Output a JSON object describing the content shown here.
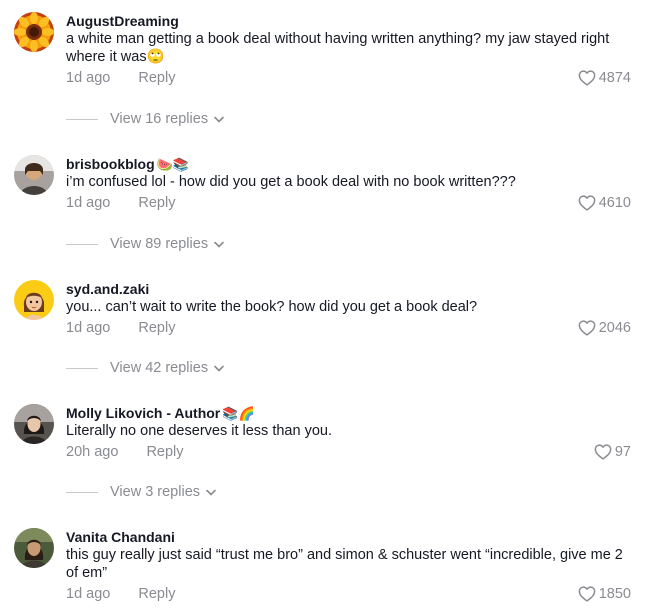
{
  "comments": [
    {
      "username": "AugustDreaming",
      "username_emoji": "",
      "text": "a white man getting a book deal without having written anything? my jaw stayed right where it was🙄",
      "time": "1d ago",
      "reply_label": "Reply",
      "likes": "4874",
      "view_replies": "View 16 replies",
      "avatar": "sunflower-avatar"
    },
    {
      "username": "brisbookblog",
      "username_emoji": "🍉📚",
      "text": "i’m confused lol - how did you get a book deal with no book written???",
      "time": "1d ago",
      "reply_label": "Reply",
      "likes": "4610",
      "view_replies": "View 89 replies",
      "avatar": "person-photo-avatar"
    },
    {
      "username": "syd.and.zaki",
      "username_emoji": "",
      "text": "you... can’t wait to write the book? how did you get a book deal?",
      "time": "1d ago",
      "reply_label": "Reply",
      "likes": "2046",
      "view_replies": "View 42 replies",
      "avatar": "memoji-avatar"
    },
    {
      "username": "Molly Likovich - Author",
      "username_emoji": "📚🌈",
      "text": "Literally no one deserves it less than you.",
      "time": "20h ago",
      "reply_label": "Reply",
      "likes": "97",
      "view_replies": "View 3 replies",
      "avatar": "person-photo-avatar"
    },
    {
      "username": "Vanita Chandani",
      "username_emoji": "",
      "text": "this guy really just said “trust me bro” and simon & schuster went “incredible, give me 2 of em”",
      "time": "1d ago",
      "reply_label": "Reply",
      "likes": "1850",
      "view_replies": "",
      "avatar": "person-photo-avatar"
    }
  ],
  "icons": {
    "like": "heart-outline-icon",
    "expand": "chevron-down-icon"
  },
  "colors": {
    "text": "#161823",
    "muted": "#8a8b91",
    "background": "#ffffff"
  }
}
